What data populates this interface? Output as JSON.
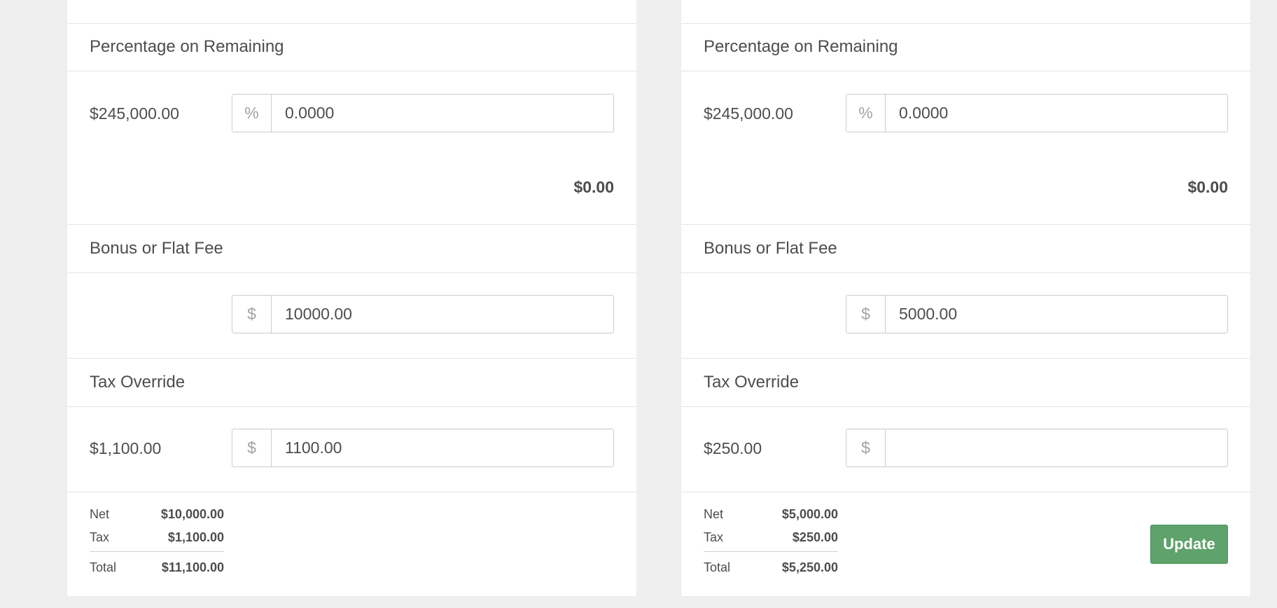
{
  "panels": [
    {
      "percentage_section": {
        "title": "Percentage on Remaining",
        "amount": "$245,000.00",
        "addon": "%",
        "value": "0.0000",
        "subtotal": "$0.00"
      },
      "bonus_section": {
        "title": "Bonus or Flat Fee",
        "addon": "$",
        "value": "10000.00"
      },
      "tax_section": {
        "title": "Tax Override",
        "amount": "$1,100.00",
        "addon": "$",
        "value": "1100.00"
      },
      "totals": {
        "net_label": "Net",
        "net_value": "$10,000.00",
        "tax_label": "Tax",
        "tax_value": "$1,100.00",
        "total_label": "Total",
        "total_value": "$11,100.00"
      }
    },
    {
      "percentage_section": {
        "title": "Percentage on Remaining",
        "amount": "$245,000.00",
        "addon": "%",
        "value": "0.0000",
        "subtotal": "$0.00"
      },
      "bonus_section": {
        "title": "Bonus or Flat Fee",
        "addon": "$",
        "value": "5000.00"
      },
      "tax_section": {
        "title": "Tax Override",
        "amount": "$250.00",
        "addon": "$",
        "value": ""
      },
      "totals": {
        "net_label": "Net",
        "net_value": "$5,000.00",
        "tax_label": "Tax",
        "tax_value": "$250.00",
        "total_label": "Total",
        "total_value": "$5,250.00"
      },
      "update_button": "Update"
    }
  ],
  "colors": {
    "background": "#efefef",
    "card": "#ffffff",
    "update_button": "#5fa26b"
  }
}
